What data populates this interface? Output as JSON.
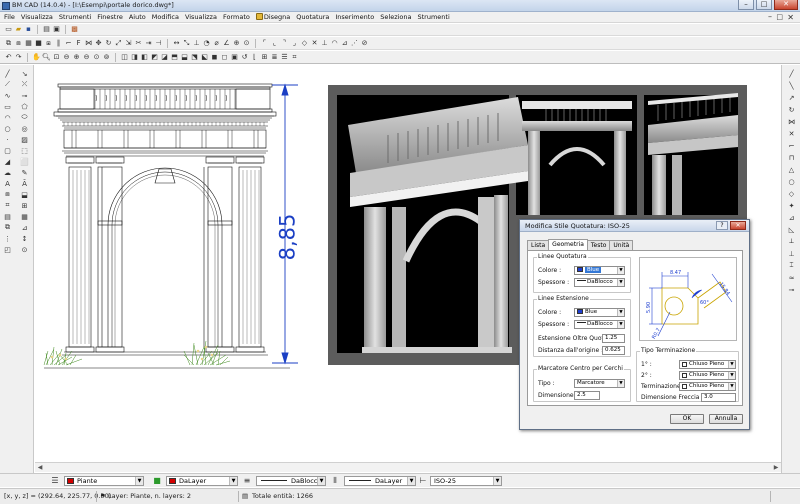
{
  "window": {
    "title": "BM CAD (14.0.4) - [I:\\Esempi\\portale dorico.dwg*]",
    "min": "–",
    "max": "□",
    "close": "✕"
  },
  "menu": {
    "items": [
      "File",
      "Visualizza",
      "Strumenti",
      "Finestre",
      "Aiuto",
      "Modifica",
      "Visualizza",
      "Formato",
      "Disegna",
      "Quotatura",
      "Inserimento",
      "Seleziona",
      "Strumenti"
    ],
    "doc_min": "–",
    "doc_max": "□",
    "doc_close": "✕"
  },
  "drawing": {
    "dimension_text": "8,85",
    "dimension_color": "#1b3fc4"
  },
  "layerbar": {
    "layer": "Piante",
    "layer_color": "#d40000",
    "color": "DaLayer",
    "color_swatch": "#d40000",
    "linetype": "DaBlocco",
    "lineweight": "DaLayer",
    "dimstyle": "ISO-25"
  },
  "status": {
    "coords": "[x, y, z] = (292.64, 225.77, 0.00)",
    "layer_info": "Layer: Piante, n. layers: 2",
    "total": "Totale entità: 1266"
  },
  "dialog": {
    "title": "Modifica Stile Quotatura: ISO-25",
    "help": "?",
    "close": "✕",
    "tabs": [
      "Lista",
      "Geometria",
      "Testo",
      "Unità"
    ],
    "active_tab": "Geometria",
    "dim_lines": {
      "title": "Linee Quotatura",
      "color_label": "Colore :",
      "color_value": "Blue",
      "color_hex": "#1f3fd0",
      "weight_label": "Spessore :",
      "weight_value": "DaBlocco"
    },
    "ext_lines": {
      "title": "Linee Estensione",
      "color_label": "Colore :",
      "color_value": "Blue",
      "color_hex": "#1f3fd0",
      "weight_label": "Spessore :",
      "weight_value": "DaBlocco",
      "beyond_label": "Estensione Oltre Quotat :",
      "beyond_value": "1.25",
      "origin_label": "Distanza dall'origine :",
      "origin_value": "0.625"
    },
    "center_marks": {
      "title": "Marcatore Centro per Cerchi",
      "type_label": "Tipo :",
      "type_value": "Marcatore",
      "size_label": "Dimensione :",
      "size_value": "2.5"
    },
    "preview": {
      "dim_top": "8.47",
      "dim_left": "5.90",
      "dim_diag": "15.84",
      "dim_angle": "60°",
      "dim_radius": "R0.7"
    },
    "arrowheads": {
      "title": "Tipo Terminazione",
      "first_label": "1° :",
      "first_value": "Chiuso Pieno",
      "second_label": "2° :",
      "second_value": "Chiuso Pieno",
      "leader_label": "Terminazione :",
      "leader_value": "Chiuso Pieno",
      "size_label": "Dimensione Freccia :",
      "size_value": "3.0"
    },
    "ok": "OK",
    "cancel": "Annulla"
  }
}
